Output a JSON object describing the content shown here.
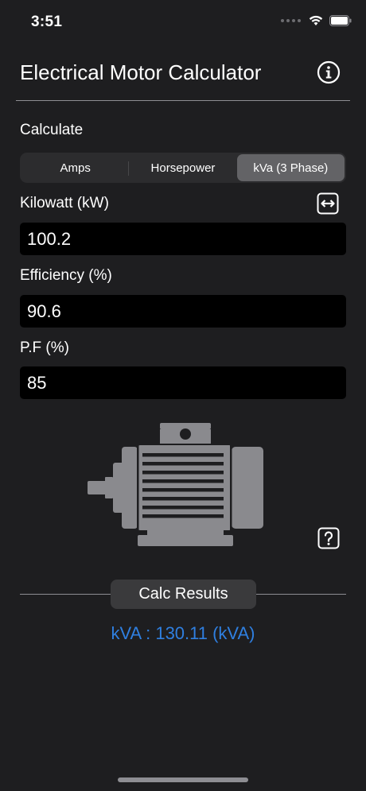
{
  "status_bar": {
    "time": "3:51"
  },
  "header": {
    "title": "Electrical Motor Calculator",
    "info_icon": "info-circle-icon"
  },
  "calculate": {
    "label": "Calculate",
    "segments": [
      {
        "label": "Amps",
        "selected": false
      },
      {
        "label": "Horsepower",
        "selected": false
      },
      {
        "label": "kVa (3 Phase)",
        "selected": true
      }
    ]
  },
  "inputs": {
    "kilowatt": {
      "label": "Kilowatt (kW)",
      "value": "100.2"
    },
    "efficiency": {
      "label": "Efficiency (%)",
      "value": "90.6"
    },
    "pf": {
      "label": "P.F (%)",
      "value": "85"
    }
  },
  "illustration": {
    "icon": "electric-motor-icon"
  },
  "results": {
    "header": "Calc Results",
    "text": "kVA : 130.11 (kVA)",
    "color": "#2f7fe0"
  },
  "colors": {
    "background": "#1e1e20",
    "accent": "#2f7fe0",
    "segment_active": "#636366"
  }
}
